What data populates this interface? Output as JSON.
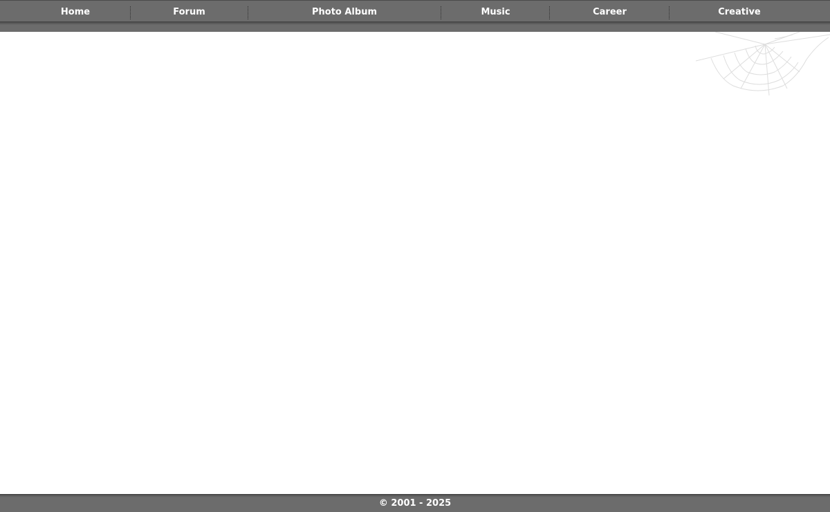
{
  "nav": {
    "items": [
      {
        "label": "Home"
      },
      {
        "label": "Forum"
      },
      {
        "label": "Photo Album"
      },
      {
        "label": "Music"
      },
      {
        "label": "Career"
      },
      {
        "label": "Creative"
      }
    ]
  },
  "footer": {
    "copyright": "© 2001 - 2025"
  },
  "decor": {
    "corner_icon": "spider-web-icon"
  },
  "colors": {
    "bar": "#6c6c6c",
    "bar_text": "#ffffff",
    "background": "#ffffff"
  }
}
